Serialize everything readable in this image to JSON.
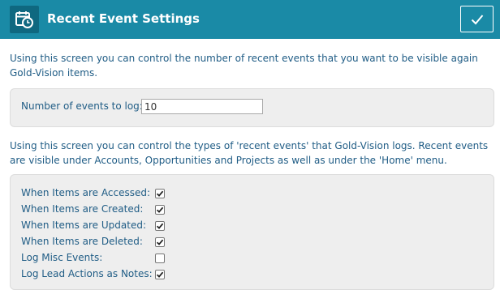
{
  "header": {
    "title": "Recent Event Settings",
    "icon": "calendar-clock-icon",
    "confirm_icon": "check-icon"
  },
  "intro1": "Using this screen you can control the number of recent events that you want to be visible again Gold-Vision items.",
  "events_to_log": {
    "label": "Number of events to log:",
    "value": "10"
  },
  "intro2": "Using this screen you can control the types of 'recent events' that Gold-Vision logs. Recent events are visible under Accounts, Opportunities and Projects as well as under the 'Home' menu.",
  "options": [
    {
      "label": "When Items are Accessed:",
      "checked": true
    },
    {
      "label": "When Items are Created:",
      "checked": true
    },
    {
      "label": "When Items are Updated:",
      "checked": true
    },
    {
      "label": "When Items are Deleted:",
      "checked": true
    },
    {
      "label": "Log Misc Events:",
      "checked": false
    },
    {
      "label": "Log Lead Actions as Notes:",
      "checked": true
    }
  ],
  "colors": {
    "header": "#1a8aa6",
    "icon_box": "#0f6880",
    "text": "#1f5c85",
    "panel": "#eeeeee"
  }
}
